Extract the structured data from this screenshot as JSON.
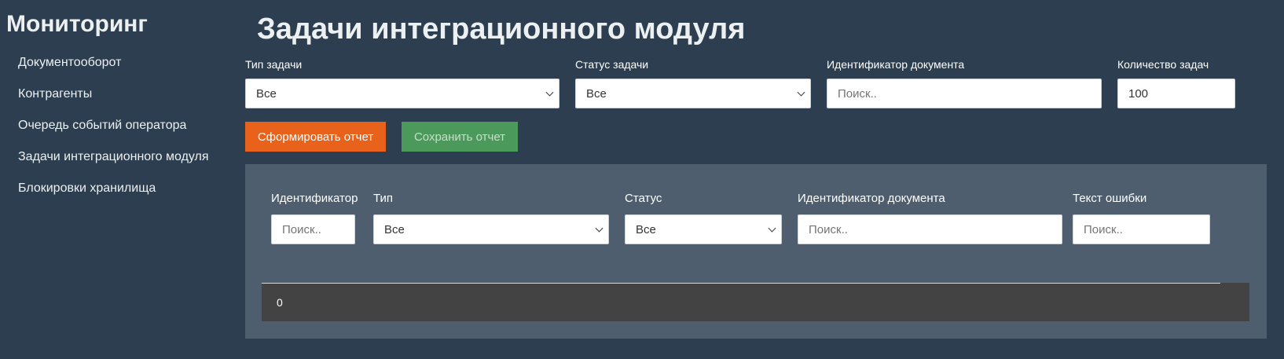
{
  "sidebar": {
    "app_title": "Мониторинг",
    "items": [
      {
        "label": "Документооборот"
      },
      {
        "label": "Контрагенты"
      },
      {
        "label": "Очередь событий оператора"
      },
      {
        "label": "Задачи интеграционного модуля"
      },
      {
        "label": "Блокировки хранилища"
      }
    ]
  },
  "main": {
    "title": "Задачи интеграционного модуля",
    "filters": {
      "task_type": {
        "label": "Тип задачи",
        "value": "Все"
      },
      "task_status": {
        "label": "Статус задачи",
        "value": "Все"
      },
      "document_id": {
        "label": "Идентификатор документа",
        "placeholder": "Поиск.."
      },
      "task_count": {
        "label": "Количество задач",
        "value": "100"
      }
    },
    "buttons": {
      "generate": "Сформировать отчет",
      "save": "Сохранить отчет"
    },
    "table_filters": {
      "id": {
        "label": "Идентификатор",
        "placeholder": "Поиск.."
      },
      "type": {
        "label": "Тип",
        "value": "Все"
      },
      "status": {
        "label": "Статус",
        "value": "Все"
      },
      "document_id": {
        "label": "Идентификатор документа",
        "placeholder": "Поиск.."
      },
      "error_text": {
        "label": "Текст ошибки",
        "placeholder": "Поиск.."
      }
    },
    "result_count": "0"
  },
  "colors": {
    "background": "#2c3e50",
    "panel": "#4e5e6e",
    "result_bar": "#434343",
    "orange_button": "#e8621c",
    "green_button": "#4c9a5b"
  }
}
